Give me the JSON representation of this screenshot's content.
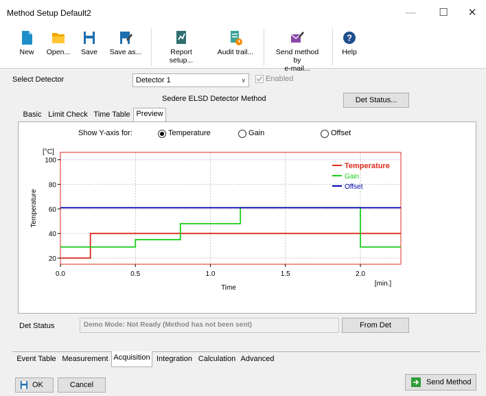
{
  "window": {
    "title": "Method Setup Default2"
  },
  "toolbar": {
    "new": "New",
    "open": "Open...",
    "save": "Save",
    "save_as": "Save as...",
    "report_setup": "Report setup...",
    "audit_trail": "Audit trail...",
    "send_method_line1": "Send method by",
    "send_method_line2": "e-mail...",
    "help": "Help"
  },
  "detector": {
    "label": "Select Detector",
    "selected": "Detector 1",
    "enabled_label": "Enabled",
    "method_title": "Sedere ELSD Detector Method",
    "det_status_button": "Det Status..."
  },
  "tabs": {
    "basic": "Basic",
    "limit_check": "Limit Check",
    "time_table": "Time Table",
    "preview": "Preview"
  },
  "yaxis_options": {
    "label": "Show Y-axis for:",
    "temperature": "Temperature",
    "gain": "Gain",
    "offset": "Offset",
    "selected": "Temperature"
  },
  "colors": {
    "temperature": "#dd2a1b",
    "gain": "#19cc19",
    "offset": "#0000b4",
    "border": "#dd2a1b"
  },
  "chart_data": {
    "type": "line",
    "xlabel": "Time",
    "x_unit": "[min.]",
    "ylabel": "Temperature",
    "y_unit": "[°C]",
    "xlim": [
      0,
      2.27
    ],
    "ylim": [
      15,
      106
    ],
    "xticks": [
      0.0,
      0.5,
      1.0,
      1.5,
      2.0
    ],
    "xtick_labels": [
      "0.0",
      "0.5",
      "1.0",
      "1.5",
      "2.0"
    ],
    "yticks": [
      20,
      40,
      60,
      80,
      100
    ],
    "ytick_labels": [
      "20",
      "40",
      "60",
      "80",
      "100"
    ],
    "grid": true,
    "legend_position": "top-right",
    "series": [
      {
        "name": "Temperature",
        "color": "#dd2a1b",
        "step": true,
        "points": [
          [
            0,
            20
          ],
          [
            0.2,
            20
          ],
          [
            0.2,
            40
          ],
          [
            2.27,
            40
          ]
        ]
      },
      {
        "name": "Gain",
        "color": "#19cc19",
        "step": true,
        "points": [
          [
            0,
            29
          ],
          [
            0.5,
            29
          ],
          [
            0.5,
            35
          ],
          [
            0.8,
            35
          ],
          [
            0.8,
            48
          ],
          [
            1.2,
            48
          ],
          [
            1.2,
            61
          ],
          [
            2.0,
            61
          ],
          [
            2.0,
            29
          ],
          [
            2.27,
            29
          ]
        ]
      },
      {
        "name": "Offset",
        "color": "#0000b4",
        "step": true,
        "points": [
          [
            0,
            61
          ],
          [
            2.27,
            61
          ]
        ]
      }
    ]
  },
  "det_status": {
    "label": "Det Status",
    "text": "Demo Mode: Not Ready (Method has not been sent)",
    "from_det_button": "From Det"
  },
  "bottom_tabs": [
    "Event Table",
    "Measurement",
    "Acquisition",
    "Integration",
    "Calculation",
    "Advanced"
  ],
  "footer": {
    "ok": "OK",
    "cancel": "Cancel",
    "send_method": "Send Method"
  }
}
